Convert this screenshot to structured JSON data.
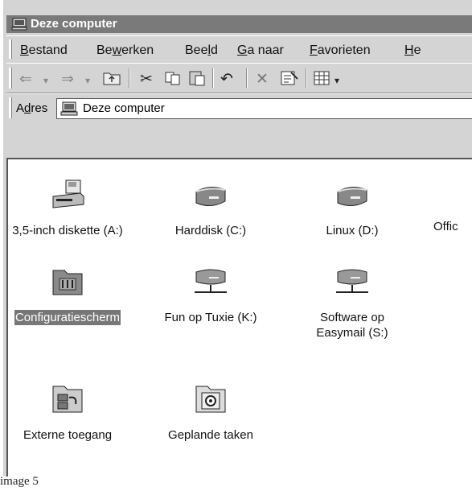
{
  "window": {
    "title": "Deze computer",
    "menu": [
      "Bestand",
      "Bewerken",
      "Beeld",
      "Ga naar",
      "Favorieten",
      "He"
    ],
    "toolbar_icons": [
      "back-arrow-icon",
      "back-dropdown-icon",
      "forward-arrow-icon",
      "forward-dropdown-icon",
      "up-folder-icon",
      "cut-icon",
      "copy-icon",
      "paste-icon",
      "undo-icon",
      "delete-icon",
      "properties-icon",
      "views-icon",
      "views-dropdown-icon"
    ],
    "address": {
      "label": "Adres",
      "value": "Deze computer"
    }
  },
  "items": [
    {
      "label": "3,5-inch diskette (A:)",
      "icon": "floppy-drive-icon"
    },
    {
      "label": "Harddisk (C:)",
      "icon": "hard-disk-icon"
    },
    {
      "label": "Linux (D:)",
      "icon": "hard-disk-icon"
    },
    {
      "label": "Offic",
      "icon": "drive-icon"
    },
    {
      "label": "Configuratiescherm",
      "icon": "control-panel-icon",
      "selected": true
    },
    {
      "label": "Fun op Tuxie (K:)",
      "icon": "network-drive-icon"
    },
    {
      "label": "Software op Easymail (S:)",
      "icon": "network-drive-icon"
    },
    {
      "label": "Externe toegang",
      "icon": "remote-access-icon"
    },
    {
      "label": "Geplande taken",
      "icon": "scheduled-tasks-icon"
    }
  ],
  "caption": "image 5",
  "colors": {
    "titlebar": "#7a7a7a",
    "selection": "#777777",
    "chrome": "#d4d4d4"
  }
}
